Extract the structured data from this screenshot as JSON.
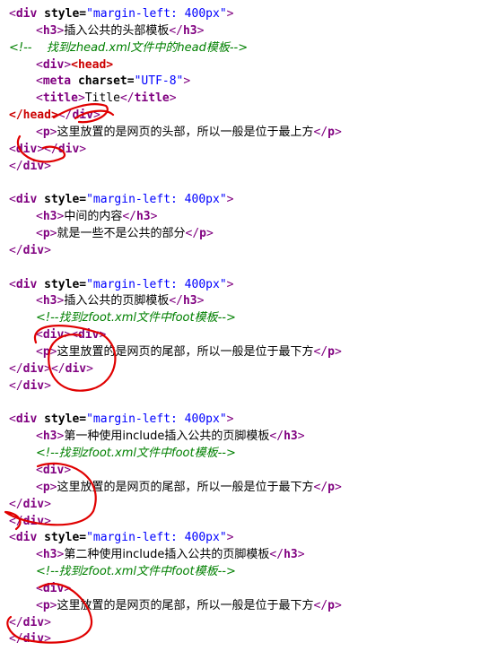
{
  "code_lines": [
    {
      "indent": 10,
      "tokens": [
        {
          "t": "<",
          "c": "tag"
        },
        {
          "t": "div",
          "c": "tagbold"
        },
        {
          "t": " style=",
          "c": "attr"
        },
        {
          "t": "\"margin-left: 400px\"",
          "c": "str"
        },
        {
          "t": ">",
          "c": "tag"
        }
      ]
    },
    {
      "indent": 40,
      "tokens": [
        {
          "t": "<",
          "c": "tag"
        },
        {
          "t": "h3",
          "c": "tagbold"
        },
        {
          "t": ">",
          "c": "tag"
        },
        {
          "t": "插入公共的头部模板",
          "c": "plain"
        },
        {
          "t": "</",
          "c": "tag"
        },
        {
          "t": "h3",
          "c": "tagbold"
        },
        {
          "t": ">",
          "c": "tag"
        }
      ]
    },
    {
      "indent": 10,
      "tokens": [
        {
          "t": "<!--    找到zhead.xml文件中的head模板-->",
          "c": "comment"
        }
      ]
    },
    {
      "indent": 40,
      "tokens": [
        {
          "t": "<",
          "c": "tag"
        },
        {
          "t": "div",
          "c": "tagbold"
        },
        {
          "t": ">",
          "c": "tag"
        },
        {
          "t": "<",
          "c": "red"
        },
        {
          "t": "head",
          "c": "red"
        },
        {
          "t": ">",
          "c": "red"
        }
      ]
    },
    {
      "indent": 40,
      "tokens": [
        {
          "t": "<",
          "c": "tag"
        },
        {
          "t": "meta",
          "c": "tagbold"
        },
        {
          "t": " charset=",
          "c": "attr"
        },
        {
          "t": "\"UTF-8\"",
          "c": "str"
        },
        {
          "t": ">",
          "c": "tag"
        }
      ]
    },
    {
      "indent": 40,
      "tokens": [
        {
          "t": "<",
          "c": "tag"
        },
        {
          "t": "title",
          "c": "tagbold"
        },
        {
          "t": ">",
          "c": "tag"
        },
        {
          "t": "Title",
          "c": "plain"
        },
        {
          "t": "</",
          "c": "tag"
        },
        {
          "t": "title",
          "c": "tagbold"
        },
        {
          "t": ">",
          "c": "tag"
        }
      ]
    },
    {
      "indent": 10,
      "tokens": [
        {
          "t": "</",
          "c": "red"
        },
        {
          "t": "head",
          "c": "red"
        },
        {
          "t": ">",
          "c": "red"
        },
        {
          "t": "</",
          "c": "tag"
        },
        {
          "t": "div",
          "c": "tagbold"
        },
        {
          "t": ">",
          "c": "tag"
        }
      ]
    },
    {
      "indent": 40,
      "tokens": [
        {
          "t": "<",
          "c": "tag"
        },
        {
          "t": "p",
          "c": "tagbold"
        },
        {
          "t": ">",
          "c": "tag"
        },
        {
          "t": "这里放置的是网页的头部，所以一般是位于最上方",
          "c": "plain"
        },
        {
          "t": "</",
          "c": "tag"
        },
        {
          "t": "p",
          "c": "tagbold"
        },
        {
          "t": ">",
          "c": "tag"
        }
      ]
    },
    {
      "indent": 10,
      "tokens": [
        {
          "t": "<",
          "c": "tag"
        },
        {
          "t": "div",
          "c": "tagbold"
        },
        {
          "t": ">",
          "c": "tag"
        },
        {
          "t": "</",
          "c": "tag"
        },
        {
          "t": "div",
          "c": "tagbold"
        },
        {
          "t": ">",
          "c": "tag"
        }
      ]
    },
    {
      "indent": 10,
      "tokens": [
        {
          "t": "</",
          "c": "tag"
        },
        {
          "t": "div",
          "c": "tagbold"
        },
        {
          "t": ">",
          "c": "tag"
        }
      ]
    },
    {
      "indent": 10,
      "tokens": []
    },
    {
      "indent": 10,
      "tokens": [
        {
          "t": "<",
          "c": "tag"
        },
        {
          "t": "div",
          "c": "tagbold"
        },
        {
          "t": " style=",
          "c": "attr"
        },
        {
          "t": "\"margin-left: 400px\"",
          "c": "str"
        },
        {
          "t": ">",
          "c": "tag"
        }
      ]
    },
    {
      "indent": 40,
      "tokens": [
        {
          "t": "<",
          "c": "tag"
        },
        {
          "t": "h3",
          "c": "tagbold"
        },
        {
          "t": ">",
          "c": "tag"
        },
        {
          "t": "中间的内容",
          "c": "plain"
        },
        {
          "t": "</",
          "c": "tag"
        },
        {
          "t": "h3",
          "c": "tagbold"
        },
        {
          "t": ">",
          "c": "tag"
        }
      ]
    },
    {
      "indent": 40,
      "tokens": [
        {
          "t": "<",
          "c": "tag"
        },
        {
          "t": "p",
          "c": "tagbold"
        },
        {
          "t": ">",
          "c": "tag"
        },
        {
          "t": "就是一些不是公共的部分",
          "c": "plain"
        },
        {
          "t": "</",
          "c": "tag"
        },
        {
          "t": "p",
          "c": "tagbold"
        },
        {
          "t": ">",
          "c": "tag"
        }
      ]
    },
    {
      "indent": 10,
      "tokens": [
        {
          "t": "</",
          "c": "tag"
        },
        {
          "t": "div",
          "c": "tagbold"
        },
        {
          "t": ">",
          "c": "tag"
        }
      ]
    },
    {
      "indent": 10,
      "tokens": []
    },
    {
      "indent": 10,
      "tokens": [
        {
          "t": "<",
          "c": "tag"
        },
        {
          "t": "div",
          "c": "tagbold"
        },
        {
          "t": " style=",
          "c": "attr"
        },
        {
          "t": "\"margin-left: 400px\"",
          "c": "str"
        },
        {
          "t": ">",
          "c": "tag"
        }
      ]
    },
    {
      "indent": 40,
      "tokens": [
        {
          "t": "<",
          "c": "tag"
        },
        {
          "t": "h3",
          "c": "tagbold"
        },
        {
          "t": ">",
          "c": "tag"
        },
        {
          "t": "插入公共的页脚模板",
          "c": "plain"
        },
        {
          "t": "</",
          "c": "tag"
        },
        {
          "t": "h3",
          "c": "tagbold"
        },
        {
          "t": ">",
          "c": "tag"
        }
      ]
    },
    {
      "indent": 40,
      "tokens": [
        {
          "t": "<!--找到zfoot.xml文件中foot模板-->",
          "c": "comment"
        }
      ]
    },
    {
      "indent": 40,
      "tokens": [
        {
          "t": "<",
          "c": "tag"
        },
        {
          "t": "div",
          "c": "tagbold"
        },
        {
          "t": ">",
          "c": "tag"
        },
        {
          "t": "<",
          "c": "tag"
        },
        {
          "t": "div",
          "c": "tagbold"
        },
        {
          "t": ">",
          "c": "tag"
        }
      ]
    },
    {
      "indent": 40,
      "tokens": [
        {
          "t": "<",
          "c": "tag"
        },
        {
          "t": "p",
          "c": "tagbold"
        },
        {
          "t": ">",
          "c": "tag"
        },
        {
          "t": "这里放置的是网页的尾部，所以一般是位于最下方",
          "c": "plain"
        },
        {
          "t": "</",
          "c": "tag"
        },
        {
          "t": "p",
          "c": "tagbold"
        },
        {
          "t": ">",
          "c": "tag"
        }
      ]
    },
    {
      "indent": 10,
      "tokens": [
        {
          "t": "</",
          "c": "tag"
        },
        {
          "t": "div",
          "c": "tagbold"
        },
        {
          "t": ">",
          "c": "tag"
        },
        {
          "t": "</",
          "c": "tag"
        },
        {
          "t": "div",
          "c": "tagbold"
        },
        {
          "t": ">",
          "c": "tag"
        }
      ]
    },
    {
      "indent": 10,
      "tokens": [
        {
          "t": "</",
          "c": "tag"
        },
        {
          "t": "div",
          "c": "tagbold"
        },
        {
          "t": ">",
          "c": "tag"
        }
      ]
    },
    {
      "indent": 10,
      "tokens": []
    },
    {
      "indent": 10,
      "tokens": [
        {
          "t": "<",
          "c": "tag"
        },
        {
          "t": "div",
          "c": "tagbold"
        },
        {
          "t": " style=",
          "c": "attr"
        },
        {
          "t": "\"margin-left: 400px\"",
          "c": "str"
        },
        {
          "t": ">",
          "c": "tag"
        }
      ]
    },
    {
      "indent": 40,
      "tokens": [
        {
          "t": "<",
          "c": "tag"
        },
        {
          "t": "h3",
          "c": "tagbold"
        },
        {
          "t": ">",
          "c": "tag"
        },
        {
          "t": "第一种使用include插入公共的页脚模板",
          "c": "plain"
        },
        {
          "t": "</",
          "c": "tag"
        },
        {
          "t": "h3",
          "c": "tagbold"
        },
        {
          "t": ">",
          "c": "tag"
        }
      ]
    },
    {
      "indent": 40,
      "tokens": [
        {
          "t": "<!--找到zfoot.xml文件中foot模板-->",
          "c": "comment"
        }
      ]
    },
    {
      "indent": 40,
      "tokens": [
        {
          "t": "<",
          "c": "tag"
        },
        {
          "t": "div",
          "c": "tagbold"
        },
        {
          "t": ">",
          "c": "tag"
        }
      ]
    },
    {
      "indent": 40,
      "tokens": [
        {
          "t": "<",
          "c": "tag"
        },
        {
          "t": "p",
          "c": "tagbold"
        },
        {
          "t": ">",
          "c": "tag"
        },
        {
          "t": "这里放置的是网页的尾部，所以一般是位于最下方",
          "c": "plain"
        },
        {
          "t": "</",
          "c": "tag"
        },
        {
          "t": "p",
          "c": "tagbold"
        },
        {
          "t": ">",
          "c": "tag"
        }
      ]
    },
    {
      "indent": 10,
      "tokens": [
        {
          "t": "</",
          "c": "tag"
        },
        {
          "t": "div",
          "c": "tagbold"
        },
        {
          "t": ">",
          "c": "tag"
        }
      ]
    },
    {
      "indent": 10,
      "tokens": [
        {
          "t": "</",
          "c": "tag"
        },
        {
          "t": "div",
          "c": "tagbold"
        },
        {
          "t": ">",
          "c": "tag"
        }
      ]
    },
    {
      "indent": 10,
      "tokens": [
        {
          "t": "<",
          "c": "tag"
        },
        {
          "t": "div",
          "c": "tagbold"
        },
        {
          "t": " style=",
          "c": "attr"
        },
        {
          "t": "\"margin-left: 400px\"",
          "c": "str"
        },
        {
          "t": ">",
          "c": "tag"
        }
      ]
    },
    {
      "indent": 40,
      "tokens": [
        {
          "t": "<",
          "c": "tag"
        },
        {
          "t": "h3",
          "c": "tagbold"
        },
        {
          "t": ">",
          "c": "tag"
        },
        {
          "t": "第二种使用include插入公共的页脚模板",
          "c": "plain"
        },
        {
          "t": "</",
          "c": "tag"
        },
        {
          "t": "h3",
          "c": "tagbold"
        },
        {
          "t": ">",
          "c": "tag"
        }
      ]
    },
    {
      "indent": 40,
      "tokens": [
        {
          "t": "<!--找到zfoot.xml文件中foot模板-->",
          "c": "comment"
        }
      ]
    },
    {
      "indent": 40,
      "tokens": [
        {
          "t": "<",
          "c": "tag"
        },
        {
          "t": "div",
          "c": "tagbold"
        },
        {
          "t": ">",
          "c": "tag"
        }
      ]
    },
    {
      "indent": 40,
      "tokens": [
        {
          "t": "<",
          "c": "tag"
        },
        {
          "t": "p",
          "c": "tagbold"
        },
        {
          "t": ">",
          "c": "tag"
        },
        {
          "t": "这里放置的是网页的尾部，所以一般是位于最下方",
          "c": "plain"
        },
        {
          "t": "</",
          "c": "tag"
        },
        {
          "t": "p",
          "c": "tagbold"
        },
        {
          "t": ">",
          "c": "tag"
        }
      ]
    },
    {
      "indent": 10,
      "tokens": [
        {
          "t": "</",
          "c": "tag"
        },
        {
          "t": "div",
          "c": "tagbold"
        },
        {
          "t": ">",
          "c": "tag"
        }
      ]
    },
    {
      "indent": 10,
      "tokens": [
        {
          "t": "</",
          "c": "tag"
        },
        {
          "t": "div",
          "c": "tagbold"
        },
        {
          "t": ">",
          "c": "tag"
        }
      ]
    }
  ],
  "colors": {
    "tag": "#800080",
    "attribute": "#000000",
    "string": "#0000ff",
    "comment": "#008000",
    "highlight": "#cc0000",
    "annotation_ink": "#e00000",
    "background": "#ffffff"
  }
}
